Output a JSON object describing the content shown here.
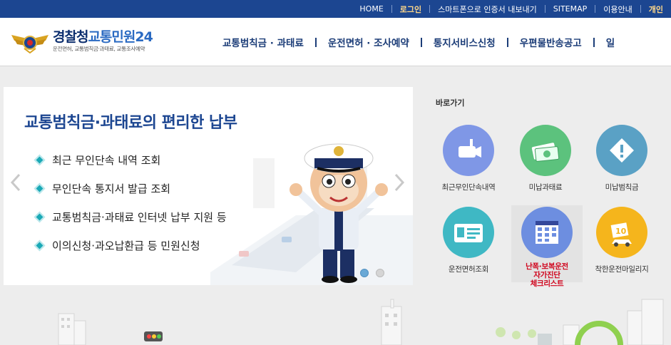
{
  "topbar": {
    "links": [
      "HOME",
      "로그인",
      "스마트폰으로 인증서 내보내기",
      "SITEMAP",
      "이용안내",
      "개인"
    ]
  },
  "logo": {
    "title_a": "경찰청",
    "title_b": "교통민원24",
    "subtitle": "운전면허, 교통범칙금·과태료, 교통조사예약"
  },
  "gnb": [
    "교통범칙금 · 과태료",
    "운전면허 · 조사예약",
    "통지서비스신청",
    "우편물반송공고",
    "일"
  ],
  "slider": {
    "headline": "교통범칙금·과태료의 편리한 납부",
    "items": [
      "최근 무인단속 내역 조회",
      "무인단속 통지서 발급 조회",
      "교통범칙금·과태료 인터넷 납부 지원 등",
      "이의신청·과오납환급 등 민원신청"
    ],
    "active_slide": 1,
    "total_slides": 2
  },
  "quick": {
    "title": "바로가기",
    "items": [
      {
        "label": "최근무인단속내역",
        "color": "#7f97e6",
        "icon": "camera-icon"
      },
      {
        "label": "미납과태료",
        "color": "#5cc27d",
        "icon": "money-icon"
      },
      {
        "label": "미납범칙금",
        "color": "#5aa1c5",
        "icon": "warning-icon"
      },
      {
        "label": "운전면허조회",
        "color": "#3fb8c4",
        "icon": "license-card-icon"
      },
      {
        "label": "난폭·보복운전\n자가진단\n체크리스트",
        "color": "#6d8ee0",
        "icon": "calendar-checklist-icon"
      },
      {
        "label": "착한운전마일리지",
        "color": "#f5b51c",
        "icon": "mileage-icon"
      }
    ]
  }
}
